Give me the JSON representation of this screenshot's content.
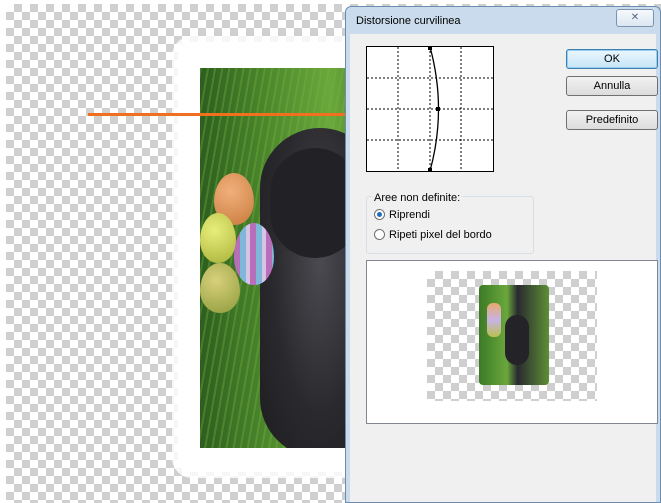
{
  "dialog": {
    "title": "Distorsione curvilinea",
    "close_icon": "close-icon",
    "buttons": {
      "ok": "OK",
      "cancel": "Annulla",
      "default": "Predefinito"
    },
    "undefined_areas": {
      "label": "Aree non definite:",
      "options": [
        {
          "label": "Riprendi",
          "checked": true
        },
        {
          "label": "Ripeti pixel del bordo",
          "checked": false
        }
      ]
    }
  },
  "annotation": {
    "arrow_color": "#f07020"
  },
  "colors": {
    "dialog_frame": "#c9dbec",
    "default_button": "#3c7fb1"
  }
}
